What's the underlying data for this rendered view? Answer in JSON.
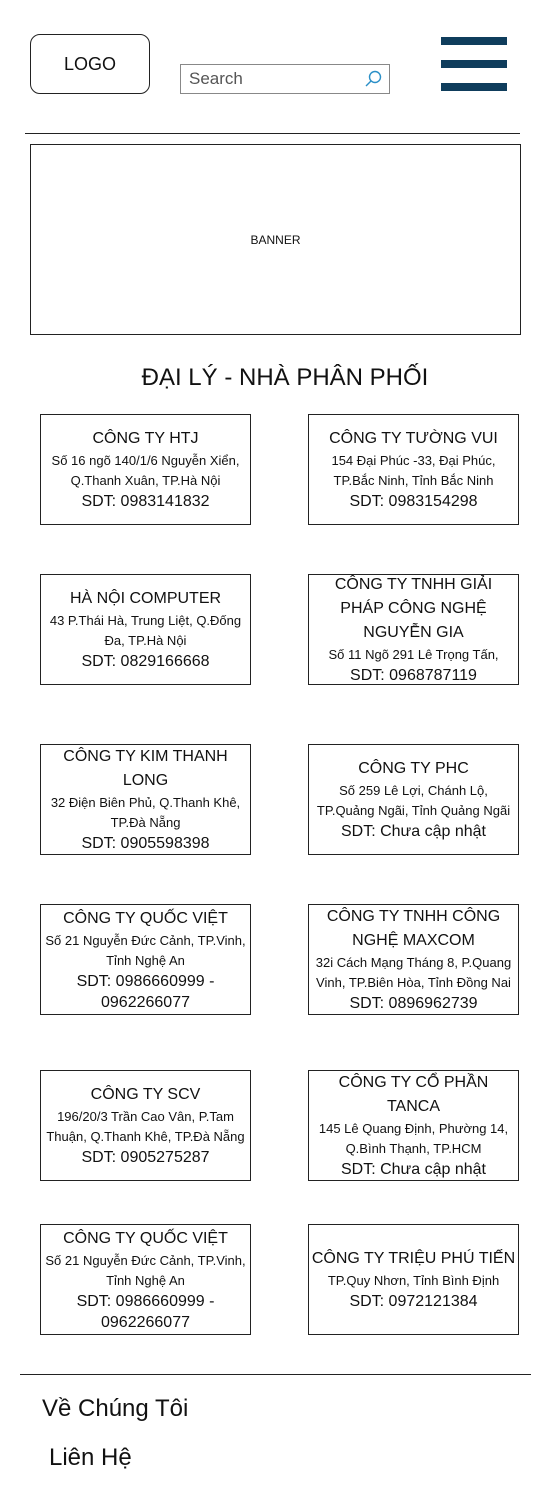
{
  "header": {
    "logo_text": "LOGO",
    "search_placeholder": "Search",
    "menu_icon": "hamburger-menu-icon",
    "accent_color": "#0f3d5c"
  },
  "banner": {
    "label": "BANNER"
  },
  "section": {
    "title": "ĐẠI LÝ - NHÀ PHÂN PHỐI"
  },
  "dealers": [
    {
      "name": "CÔNG TY HTJ",
      "address": "Số 16 ngõ 140/1/6 Nguyễn Xiển, Q.Thanh Xuân, TP.Hà Nội",
      "phone": "SDT: 0983141832"
    },
    {
      "name": "CÔNG TY TƯỜNG VUI",
      "address": "154 Đại Phúc -33, Đại Phúc, TP.Bắc Ninh, Tỉnh Bắc Ninh",
      "phone": "SDT: 0983154298"
    },
    {
      "name": "HÀ NỘI COMPUTER",
      "address": "43 P.Thái Hà, Trung Liệt, Q.Đống Đa, TP.Hà Nội",
      "phone": "SDT: 0829166668"
    },
    {
      "name": "CÔNG TY TNHH GIẢI PHÁP CÔNG NGHỆ NGUYỄN GIA",
      "address": "Số 11 Ngõ 291 Lê Trọng Tấn,",
      "phone": "SDT: 0968787119"
    },
    {
      "name": "CÔNG TY KIM THANH LONG",
      "address": "32 Điện Biên Phủ, Q.Thanh Khê, TP.Đà Nẵng",
      "phone": "SDT: 0905598398"
    },
    {
      "name": "CÔNG TY PHC",
      "address": "Số 259 Lê Lợi, Chánh Lộ, TP.Quảng Ngãi, Tỉnh Quảng Ngãi",
      "phone": "SDT: Chưa cập nhật"
    },
    {
      "name": "CÔNG TY QUỐC VIỆT",
      "address": "Số 21 Nguyễn Đức Cảnh, TP.Vinh, Tỉnh Nghệ An",
      "phone": "SDT: 0986660999 - 0962266077"
    },
    {
      "name": "CÔNG TY TNHH CÔNG NGHỆ MAXCOM",
      "address": "32i Cách Mạng Tháng 8, P.Quang Vinh, TP.Biên Hòa, Tỉnh Đồng Nai",
      "phone": "SDT: 0896962739"
    },
    {
      "name": "CÔNG TY SCV",
      "address": "196/20/3 Trần Cao Vân, P.Tam Thuận, Q.Thanh Khê, TP.Đà Nẵng",
      "phone": "SDT: 0905275287"
    },
    {
      "name": "CÔNG TY CỔ PHẦN TANCA",
      "address": "145 Lê Quang Định, Phường 14, Q.Bình Thạnh, TP.HCM",
      "phone": "SDT: Chưa cập nhật"
    },
    {
      "name": "CÔNG TY QUỐC VIỆT",
      "address": "Số 21 Nguyễn Đức Cảnh, TP.Vinh, Tỉnh Nghệ An",
      "phone": "SDT: 0986660999 - 0962266077"
    },
    {
      "name": "CÔNG TY TRIỆU PHÚ TIẾN",
      "address": "TP.Quy Nhơn, Tỉnh Bình Định",
      "phone": "SDT: 0972121384"
    }
  ],
  "footer": {
    "about_label": "Về Chúng Tôi",
    "contact_label": "Liên Hệ"
  }
}
